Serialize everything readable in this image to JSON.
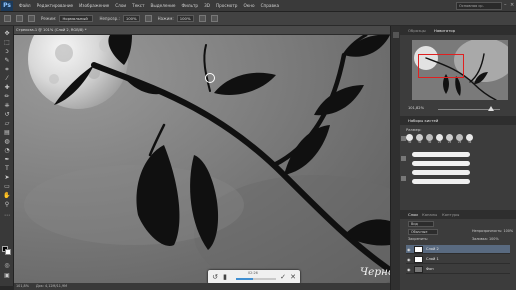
{
  "app": {
    "logo": "Ps"
  },
  "menu": [
    "Файл",
    "Редактирование",
    "Изображение",
    "Слои",
    "Текст",
    "Выделение",
    "Фильтр",
    "3D",
    "Просмотр",
    "Окно",
    "Справка"
  ],
  "search": {
    "text": "Основная ср."
  },
  "options": {
    "mode_label": "Режим:",
    "mode_value": "Нормальный",
    "opacity_label": "Непрозр.:",
    "opacity_value": "100%",
    "pressure_label": "Нажим:",
    "pressure_value": "100%"
  },
  "document": {
    "tab_title": "Стрекоза-1 @ 101% (Слой 2, RGB/8) *"
  },
  "status": {
    "zoom": "101,8%",
    "doc": "Док: 4,12M/11,9M"
  },
  "playback": {
    "time": "02:26",
    "progress": 0.42
  },
  "watermark": "Черно-белая АРТосфера",
  "panels": {
    "top_tabs": [
      "Образцы",
      "Навигатор"
    ],
    "active_top_tab": "Навигатор",
    "navigator_zoom": "101,82%",
    "brush_tabs": [
      "Наборы кистей"
    ],
    "brush_preset_label": "Размер:",
    "brush_sizes": [
      "30",
      "30",
      "30",
      "25",
      "25",
      "25",
      "36",
      "25",
      "36",
      "36",
      "32",
      "25"
    ],
    "layers_tabs": [
      "Слои",
      "Каналы",
      "Контуры"
    ],
    "layers_filter": "Вид",
    "layers_mode": "Обычные",
    "layers_opacity": "Непрозрачность: 100%",
    "layers_lock": "Закрепить:",
    "layers_fill": "Заливка: 100%",
    "layers": [
      {
        "name": "Слой 2",
        "selected": true
      },
      {
        "name": "Слой 1",
        "selected": false
      },
      {
        "name": "Фон",
        "selected": false
      }
    ]
  }
}
